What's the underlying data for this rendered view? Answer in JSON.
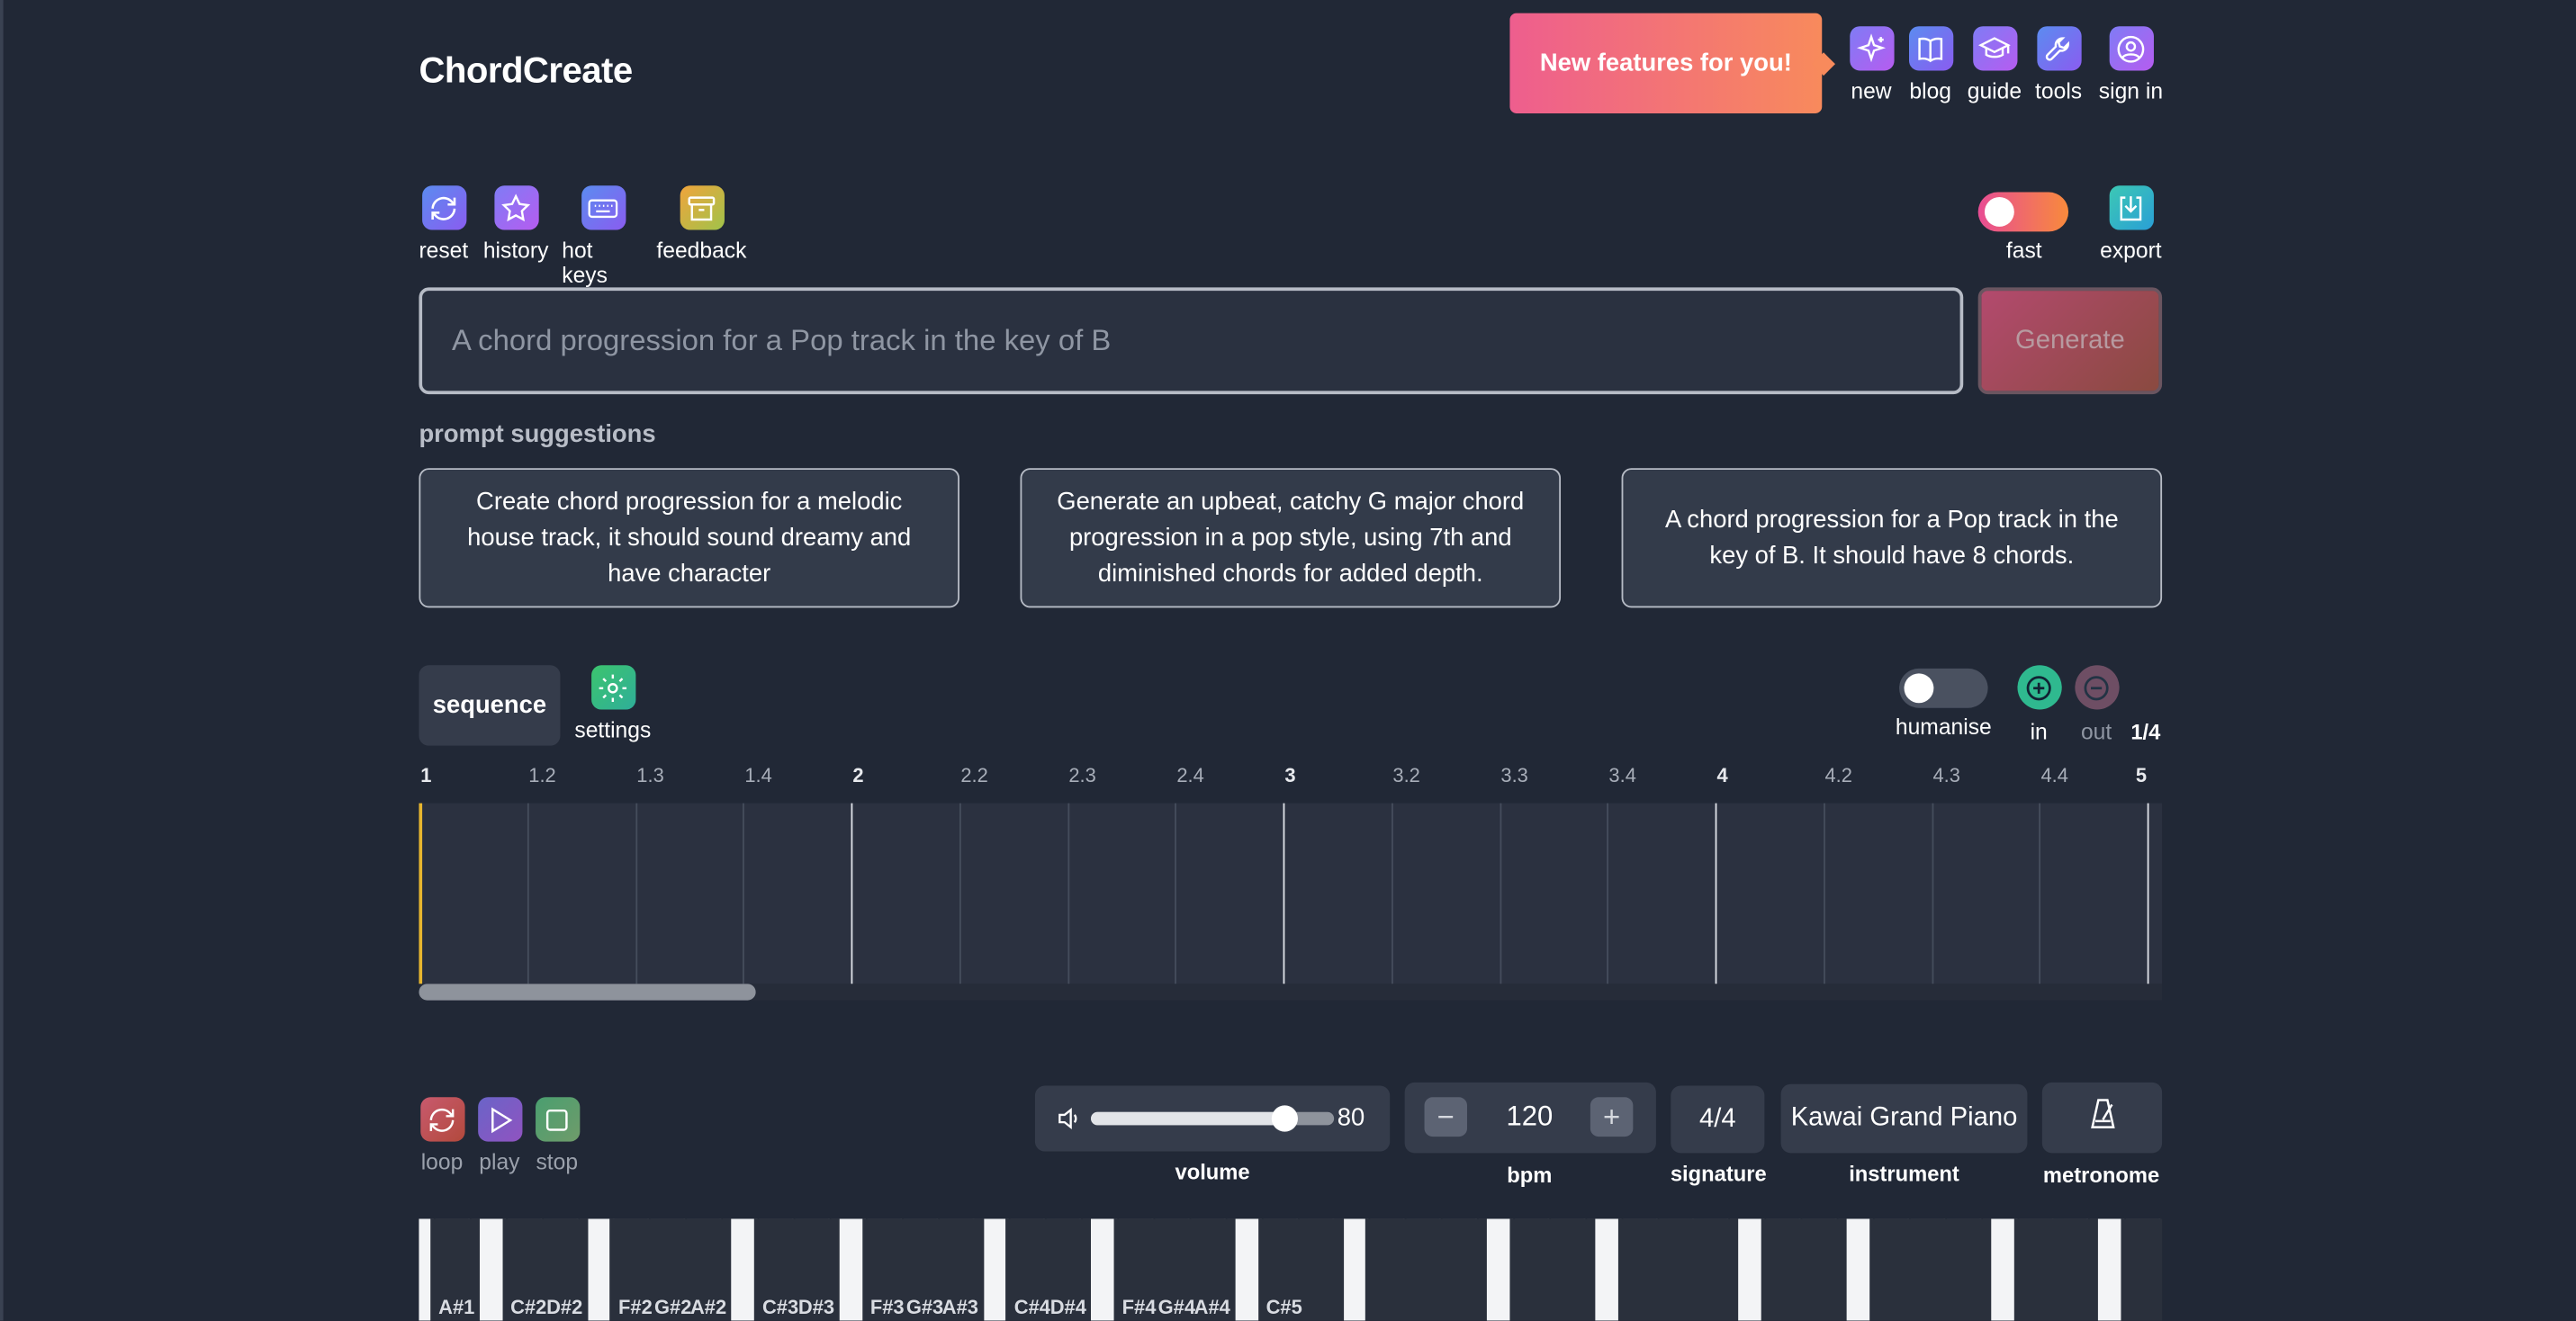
{
  "header": {
    "logo": "ChordCreate",
    "features_banner": "New features for you!",
    "nav": [
      {
        "label": "new",
        "icon": "sparkles-icon"
      },
      {
        "label": "blog",
        "icon": "book-icon"
      },
      {
        "label": "guide",
        "icon": "graduation-cap-icon"
      },
      {
        "label": "tools",
        "icon": "wrench-icon"
      },
      {
        "label": "sign in",
        "icon": "user-icon"
      }
    ]
  },
  "toolbar": {
    "reset": "reset",
    "history": "history",
    "hot_keys": "hot keys",
    "feedback": "feedback",
    "fast": "fast",
    "export": "export"
  },
  "prompt": {
    "placeholder": "A chord progression for a Pop track in the key of B",
    "generate": "Generate"
  },
  "suggestions": {
    "title": "prompt suggestions",
    "items": [
      "Create chord progression for a melodic house track, it should sound dreamy and have character",
      "Generate an upbeat, catchy G major chord progression in a pop style, using 7th and diminished chords for added depth.",
      "A chord progression for a Pop track in the key of B. It should have 8 chords."
    ]
  },
  "sequence": {
    "tab": "sequence",
    "settings": "settings",
    "humanise": "humanise",
    "zoom_in": "in",
    "zoom_out": "out",
    "zoom_value": "1/4",
    "ruler": [
      "1",
      "1.2",
      "1.3",
      "1.4",
      "2",
      "2.2",
      "2.3",
      "2.4",
      "3",
      "3.2",
      "3.3",
      "3.4",
      "4",
      "4.2",
      "4.3",
      "4.4",
      "5"
    ]
  },
  "transport": {
    "loop": "loop",
    "play": "play",
    "stop": "stop",
    "volume_value": "80",
    "volume_level": 0.8,
    "volume_label": "volume",
    "bpm_value": "120",
    "bpm_label": "bpm",
    "signature_value": "4/4",
    "signature_label": "signature",
    "instrument_value": "Kawai Grand Piano",
    "instrument_label": "instrument",
    "metronome_label": "metronome"
  },
  "keyboard": {
    "labels": [
      "A#1",
      "C#2",
      "D#2",
      "F#2",
      "G#2",
      "A#2",
      "C#3",
      "D#3",
      "F#3",
      "G#3",
      "A#3",
      "C#4",
      "D#4",
      "F#4",
      "G#4",
      "A#4",
      "C#5"
    ]
  },
  "colors": {
    "background": "#212836",
    "panel": "#353c4b",
    "playhead": "#e8b62f",
    "accent_pink": "#ee5e8e",
    "accent_orange": "#f88a5c"
  }
}
